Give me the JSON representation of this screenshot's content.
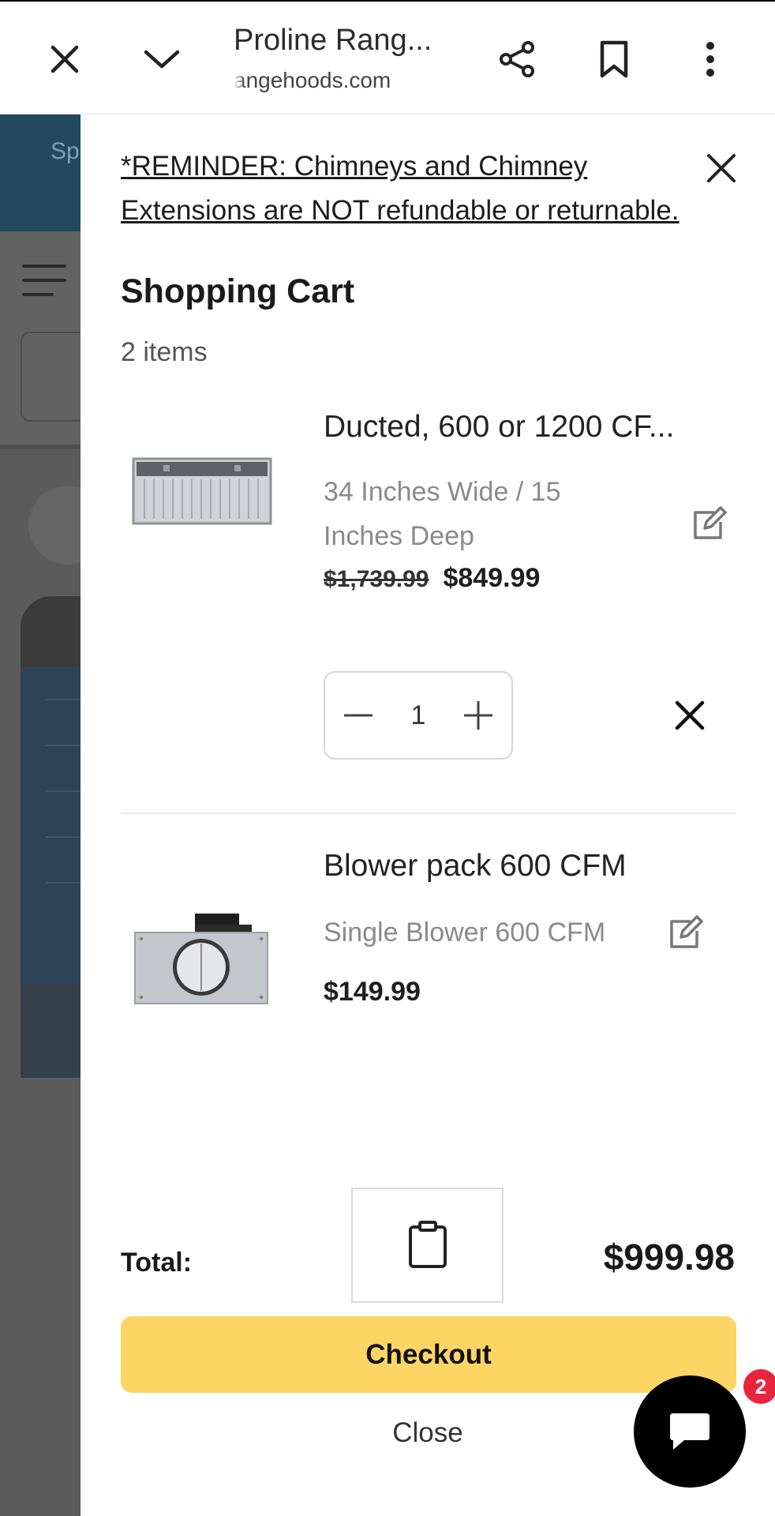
{
  "browser": {
    "page_title": "Proline Rang...",
    "url": "angehoods.com"
  },
  "background": {
    "banner_text": "Sp"
  },
  "cart": {
    "reminder": "*REMINDER: Chimneys and Chimney Extensions are NOT refundable or returnable.",
    "title": "Shopping Cart",
    "item_count": "2 items",
    "items": [
      {
        "name": "Ducted, 600 or 1200 CF...",
        "variant": "34 Inches Wide / 15 Inches Deep",
        "old_price": "$1,739.99",
        "price": "$849.99",
        "quantity": "1"
      },
      {
        "name": "Blower pack 600 CFM",
        "variant": "Single Blower 600 CFM",
        "price": "$149.99"
      }
    ],
    "total_label": "Total:",
    "total_value": "$999.98",
    "checkout_label": "Checkout",
    "close_label": "Close"
  },
  "chat": {
    "badge_count": "2"
  },
  "colors": {
    "checkout_bg": "#fdd565",
    "badge": "#e8253c",
    "banner": "#23495c"
  }
}
